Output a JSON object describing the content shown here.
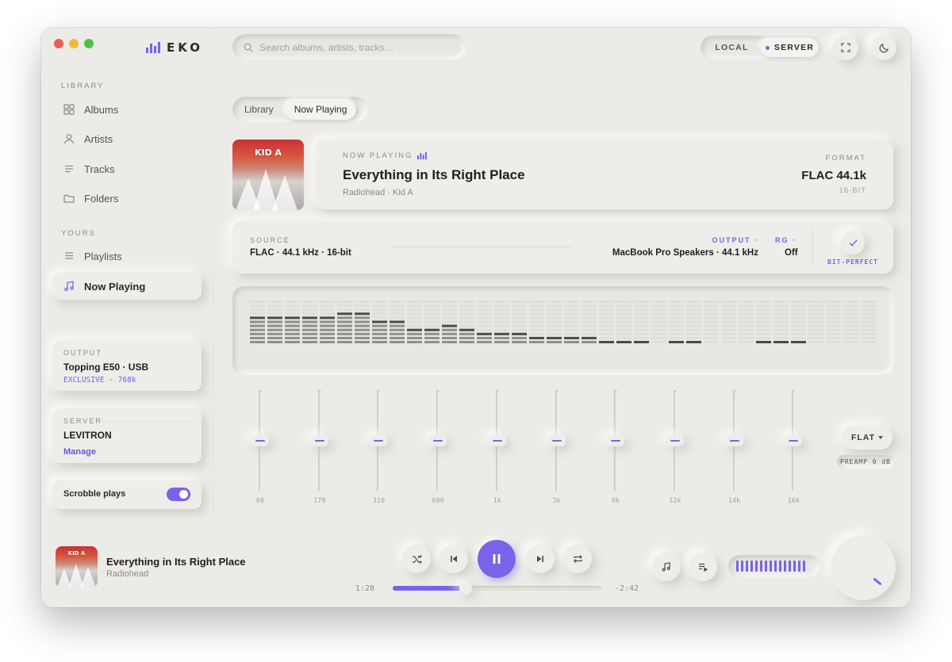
{
  "app": {
    "name": "EKO"
  },
  "search": {
    "placeholder": "Search albums, artists, tracks…"
  },
  "mode": {
    "local": "LOCAL",
    "server": "SERVER",
    "active": "SERVER"
  },
  "sidebar": {
    "library_label": "LIBRARY",
    "library_items": [
      {
        "label": "Albums",
        "icon": "grid-icon"
      },
      {
        "label": "Artists",
        "icon": "user-icon"
      },
      {
        "label": "Tracks",
        "icon": "list-icon"
      },
      {
        "label": "Folders",
        "icon": "folder-icon"
      }
    ],
    "yours_label": "YOURS",
    "yours_items": [
      {
        "label": "Playlists",
        "icon": "playlist-icon"
      },
      {
        "label": "Now Playing",
        "icon": "music-note-icon",
        "active": true
      }
    ],
    "output": {
      "label": "OUTPUT",
      "device": "Topping E50 · USB",
      "mode": "EXCLUSIVE",
      "rate": "768k"
    },
    "server": {
      "label": "SERVER",
      "name": "LEVITRON",
      "link": "Manage"
    },
    "scrobble": {
      "label": "Scrobble plays",
      "enabled": true
    }
  },
  "tabs": [
    {
      "label": "Library",
      "active": false
    },
    {
      "label": "Now Playing",
      "active": true
    }
  ],
  "now_playing": {
    "label": "NOW PLAYING",
    "title": "Everything in Its Right Place",
    "artist": "Radiohead",
    "album": "Kid A",
    "subtitle": "Radiohead · Kid A",
    "cover_text": "KID A",
    "format_label": "FORMAT",
    "format": "FLAC 44.1k",
    "bit_depth": "16-BIT"
  },
  "signal_chain": {
    "source_label": "SOURCE",
    "source_value": "FLAC · 44.1 kHz · 16-bit",
    "output_label": "OUTPUT ·",
    "output_value": "MacBook Pro Speakers · 44.1 kHz",
    "rg_label": "RG ·",
    "rg_value": "Off",
    "bit_perfect": "BIT-PERFECT"
  },
  "spectrum": {
    "levels": [
      0.6,
      0.6,
      0.6,
      0.6,
      0.6,
      0.73,
      0.73,
      0.55,
      0.55,
      0.34,
      0.34,
      0.42,
      0.34,
      0.27,
      0.27,
      0.27,
      0.16,
      0.16,
      0.16,
      0.16,
      0.09,
      0.09,
      0.09,
      0.0,
      0.09,
      0.09,
      0.03,
      0.03,
      0.03,
      0.09,
      0.09,
      0.09,
      0.0,
      0.0,
      0.03,
      0.0
    ],
    "segments": 11
  },
  "equalizer": {
    "bands": [
      {
        "freq": "60",
        "gain_db": 0
      },
      {
        "freq": "170",
        "gain_db": 0
      },
      {
        "freq": "310",
        "gain_db": 0
      },
      {
        "freq": "600",
        "gain_db": 0
      },
      {
        "freq": "1k",
        "gain_db": 0
      },
      {
        "freq": "3k",
        "gain_db": 0
      },
      {
        "freq": "6k",
        "gain_db": 0
      },
      {
        "freq": "12k",
        "gain_db": 0
      },
      {
        "freq": "14k",
        "gain_db": 0
      },
      {
        "freq": "16k",
        "gain_db": 0
      }
    ],
    "preset": "FLAT",
    "preamp": "PREAMP 0 dB"
  },
  "player": {
    "title": "Everything in Its Right Place",
    "artist": "Radiohead",
    "cover_text": "KID A",
    "elapsed": "1:28",
    "remaining": "-2:42",
    "progress": 0.35,
    "volume_bars": 15
  },
  "colors": {
    "accent": "#7a63e8",
    "background": "#ecebe7"
  }
}
